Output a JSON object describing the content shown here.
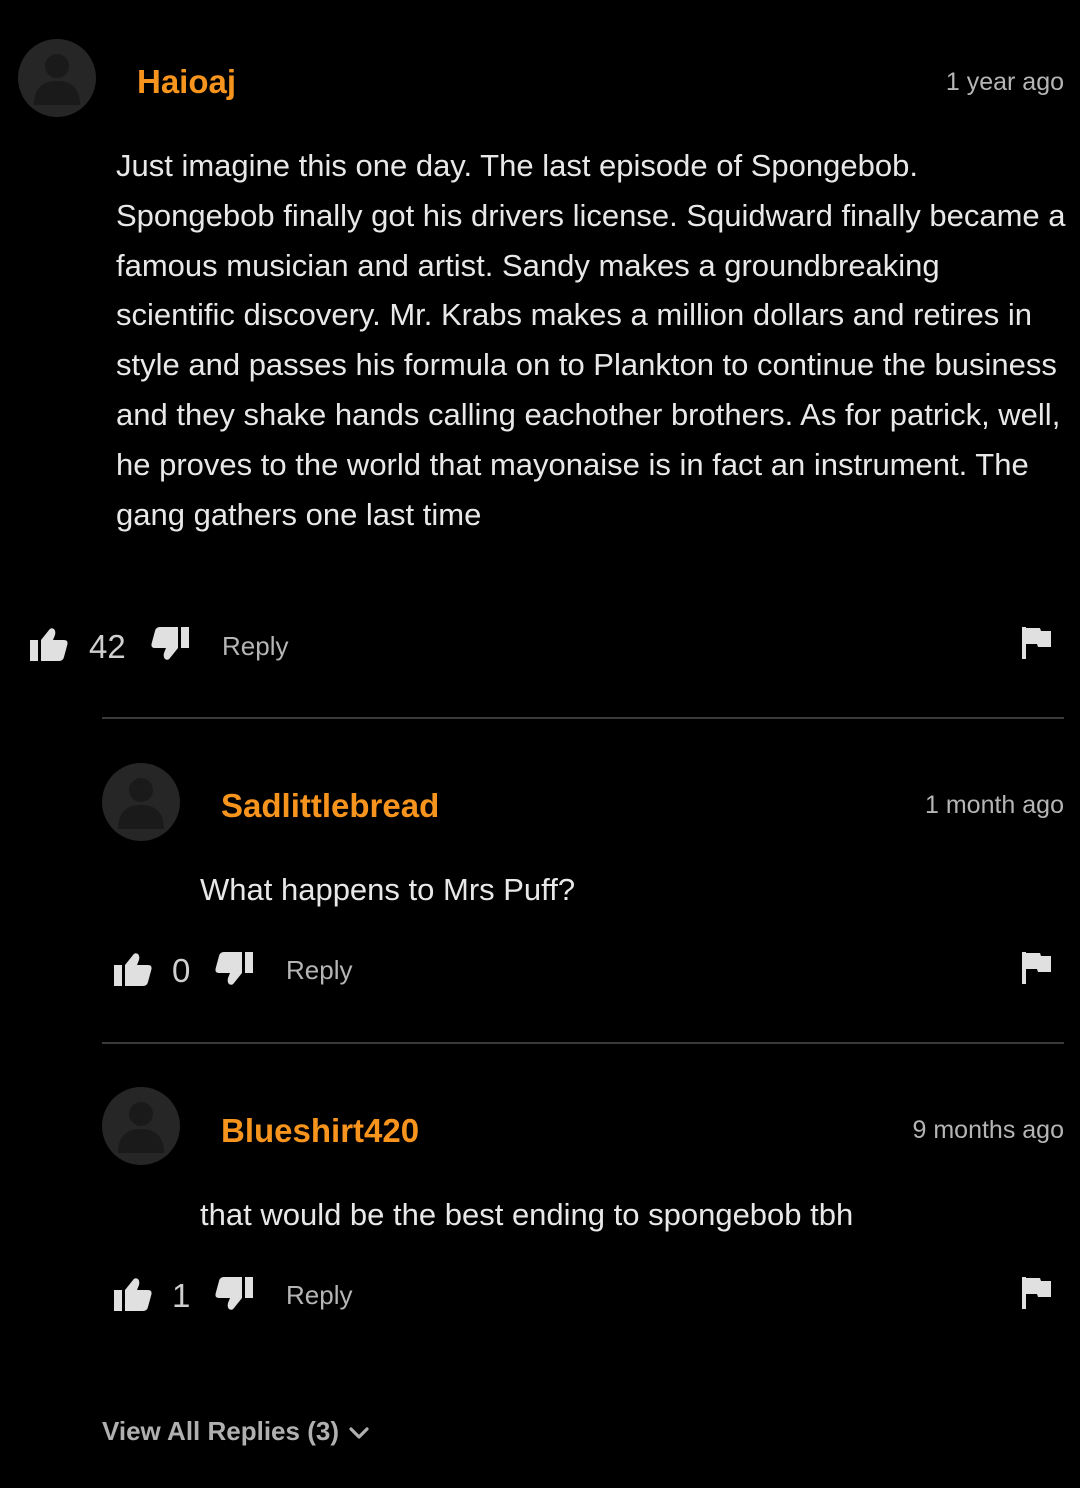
{
  "comment": {
    "username": "Haioaj",
    "timestamp": "1 year ago",
    "text": "Just imagine this one day. The last episode of Spongebob. Spongebob finally got his drivers license. Squidward finally became a famous musician and artist. Sandy makes a groundbreaking scientific discovery. Mr. Krabs makes a million dollars and retires in style and passes his formula on to Plankton to continue the business and they shake hands calling eachother brothers. As for patrick, well, he proves to the world that mayonaise is in fact an instrument. The gang gathers one last time",
    "likes": "42",
    "reply_label": "Reply"
  },
  "replies": [
    {
      "username": "Sadlittlebread",
      "timestamp": "1 month ago",
      "text": "What happens to Mrs Puff?",
      "likes": "0",
      "reply_label": "Reply"
    },
    {
      "username": "Blueshirt420",
      "timestamp": "9 months ago",
      "text": "that would be the best ending to spongebob tbh",
      "likes": "1",
      "reply_label": "Reply"
    }
  ],
  "view_all": {
    "label": "View All Replies (3)"
  },
  "colors": {
    "background": "#000000",
    "username": "#f7941d",
    "text": "#e8e8e8",
    "muted": "#b5b5b5",
    "divider": "#3a3a3a"
  },
  "icons": [
    "avatar-placeholder-icon",
    "thumbs-up-icon",
    "thumbs-down-icon",
    "flag-icon",
    "chevron-down-icon"
  ]
}
